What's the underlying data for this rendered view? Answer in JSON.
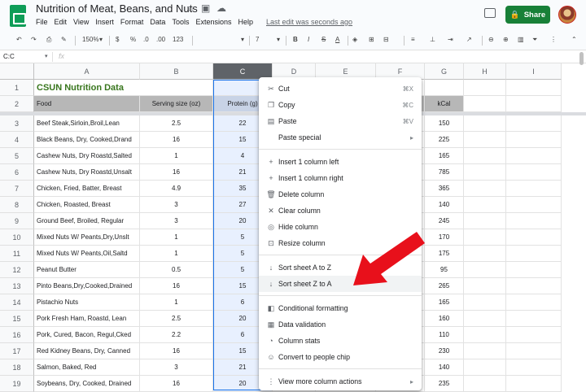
{
  "app": {
    "doc_title": "Nutrition of Meat, Beans, and Nuts",
    "menus": [
      "File",
      "Edit",
      "View",
      "Insert",
      "Format",
      "Data",
      "Tools",
      "Extensions",
      "Help"
    ],
    "last_edit": "Last edit was seconds ago",
    "share_label": "Share"
  },
  "toolbar": {
    "zoom": "150%",
    "currency": "$",
    "percent": "%",
    "dec_less": ".0",
    "dec_more": ".00",
    "format_more": "123",
    "font_size": "7"
  },
  "formula_bar": {
    "name_box": "C:C",
    "fx": "fx",
    "value": ""
  },
  "columns": [
    {
      "label": "A",
      "w": 130
    },
    {
      "label": "B",
      "w": 90
    },
    {
      "label": "C",
      "w": 73
    },
    {
      "label": "D",
      "w": 53
    },
    {
      "label": "E",
      "w": 74
    },
    {
      "label": "F",
      "w": 60
    },
    {
      "label": "G",
      "w": 48
    },
    {
      "label": "H",
      "w": 52
    },
    {
      "label": "I",
      "w": 68
    }
  ],
  "title_cell": "CSUN Nutrition Data",
  "header_row": {
    "food": "Food",
    "serving": "Serving size (oz)",
    "protein": "Protein (g)",
    "kcal": "kCal"
  },
  "rows": [
    {
      "n": "3",
      "food": "Beef Steak,Sirloin,Broil,Lean",
      "serving": "2.5",
      "protein": "22",
      "kcal": "150"
    },
    {
      "n": "4",
      "food": "Black Beans, Dry, Cooked,Drand",
      "serving": "16",
      "protein": "15",
      "kcal": "225"
    },
    {
      "n": "5",
      "food": "Cashew Nuts, Dry Roastd,Salted",
      "serving": "1",
      "protein": "4",
      "kcal": "165"
    },
    {
      "n": "6",
      "food": "Cashew Nuts, Dry Roastd,Unsalt",
      "serving": "16",
      "protein": "21",
      "kcal": "785"
    },
    {
      "n": "7",
      "food": "Chicken, Fried, Batter, Breast",
      "serving": "4.9",
      "protein": "35",
      "kcal": "365"
    },
    {
      "n": "8",
      "food": "Chicken, Roasted, Breast",
      "serving": "3",
      "protein": "27",
      "kcal": "140"
    },
    {
      "n": "9",
      "food": "Ground Beef, Broiled, Regular",
      "serving": "3",
      "protein": "20",
      "kcal": "245"
    },
    {
      "n": "10",
      "food": "Mixed Nuts W/ Peants,Dry,Unslt",
      "serving": "1",
      "protein": "5",
      "kcal": "170"
    },
    {
      "n": "11",
      "food": "Mixed Nuts W/ Peants,Oil,Saltd",
      "serving": "1",
      "protein": "5",
      "kcal": "175"
    },
    {
      "n": "12",
      "food": "Peanut Butter",
      "serving": "0.5",
      "protein": "5",
      "kcal": "95"
    },
    {
      "n": "13",
      "food": "Pinto Beans,Dry,Cooked,Drained",
      "serving": "16",
      "protein": "15",
      "kcal": "265"
    },
    {
      "n": "14",
      "food": "Pistachio Nuts",
      "serving": "1",
      "protein": "6",
      "kcal": "165"
    },
    {
      "n": "15",
      "food": "Pork Fresh Ham, Roastd, Lean",
      "serving": "2.5",
      "protein": "20",
      "kcal": "160"
    },
    {
      "n": "16",
      "food": "Pork, Cured, Bacon, Regul,Cked",
      "serving": "2.2",
      "protein": "6",
      "kcal": "110"
    },
    {
      "n": "17",
      "food": "Red Kidney Beans, Dry, Canned",
      "serving": "16",
      "protein": "15",
      "kcal": "230"
    },
    {
      "n": "18",
      "food": "Salmon, Baked, Red",
      "serving": "3",
      "protein": "21",
      "kcal": "140"
    },
    {
      "n": "19",
      "food": "Soybeans, Dry, Cooked, Drained",
      "serving": "16",
      "protein": "20",
      "kcal": "235"
    }
  ],
  "context_menu": [
    {
      "label": "Cut",
      "shortcut": "⌘X",
      "icon": "cut-icon",
      "glyph": "✂"
    },
    {
      "label": "Copy",
      "shortcut": "⌘C",
      "icon": "copy-icon",
      "glyph": "❐"
    },
    {
      "label": "Paste",
      "shortcut": "⌘V",
      "icon": "paste-icon",
      "glyph": "▤"
    },
    {
      "label": "Paste special",
      "shortcut": "▸",
      "icon": "",
      "glyph": ""
    },
    {
      "sep": true
    },
    {
      "label": "Insert 1 column left",
      "icon": "plus-icon",
      "glyph": "+"
    },
    {
      "label": "Insert 1 column right",
      "icon": "plus-icon",
      "glyph": "+"
    },
    {
      "label": "Delete column",
      "icon": "trash-icon",
      "glyph": "🗑"
    },
    {
      "label": "Clear column",
      "icon": "close-icon",
      "glyph": "✕"
    },
    {
      "label": "Hide column",
      "icon": "hide-icon",
      "glyph": "◎"
    },
    {
      "label": "Resize column",
      "icon": "resize-icon",
      "glyph": "⊡"
    },
    {
      "sep": true
    },
    {
      "label": "Sort sheet A to Z",
      "icon": "sort-az-icon",
      "glyph": "↓"
    },
    {
      "label": "Sort sheet Z to A",
      "icon": "sort-za-icon",
      "glyph": "↓",
      "highlight": true
    },
    {
      "sep": true
    },
    {
      "label": "Conditional formatting",
      "icon": "paint-icon",
      "glyph": "◧"
    },
    {
      "label": "Data validation",
      "icon": "validation-icon",
      "glyph": "▦"
    },
    {
      "label": "Column stats",
      "icon": "stats-icon",
      "glyph": "◔"
    },
    {
      "label": "Convert to people chip",
      "icon": "people-chip-icon",
      "glyph": "☺"
    },
    {
      "sep": true
    },
    {
      "label": "View more column actions",
      "shortcut": "▸",
      "icon": "more-icon",
      "glyph": "⋮"
    }
  ],
  "colors": {
    "accent": "#1a73e8",
    "title_green": "#38761d",
    "share_green": "#188038",
    "arrow_red": "#e8101b"
  }
}
